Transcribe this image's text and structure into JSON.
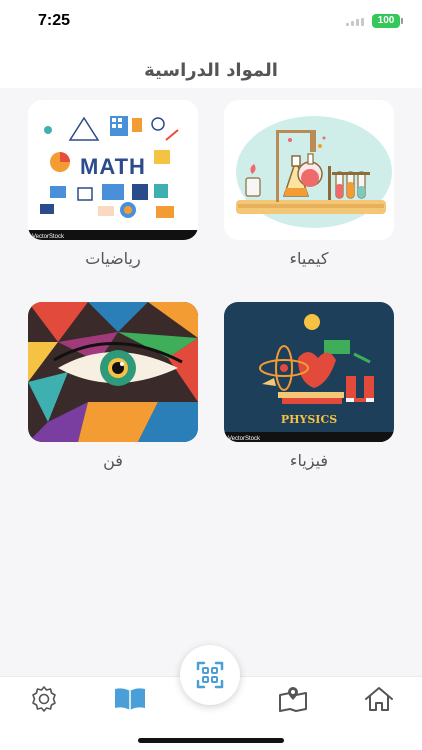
{
  "status_bar": {
    "time": "7:25",
    "battery": "100"
  },
  "header": {
    "title": "المواد الدراسية"
  },
  "subjects": [
    {
      "label": "كيمياء",
      "icon": "chemistry-illustration"
    },
    {
      "label": "رياضيات",
      "icon": "math-illustration"
    },
    {
      "label": "فيزياء",
      "icon": "physics-illustration",
      "image_text": "PHYSICS"
    },
    {
      "label": "فن",
      "icon": "art-eye-illustration"
    }
  ],
  "watermark": "VectorStock",
  "nav": {
    "items": [
      "home-icon",
      "map-book-icon",
      "scan-icon",
      "book-icon",
      "settings-icon"
    ],
    "active_color": "#4a9fd8",
    "inactive_color": "#555555"
  }
}
